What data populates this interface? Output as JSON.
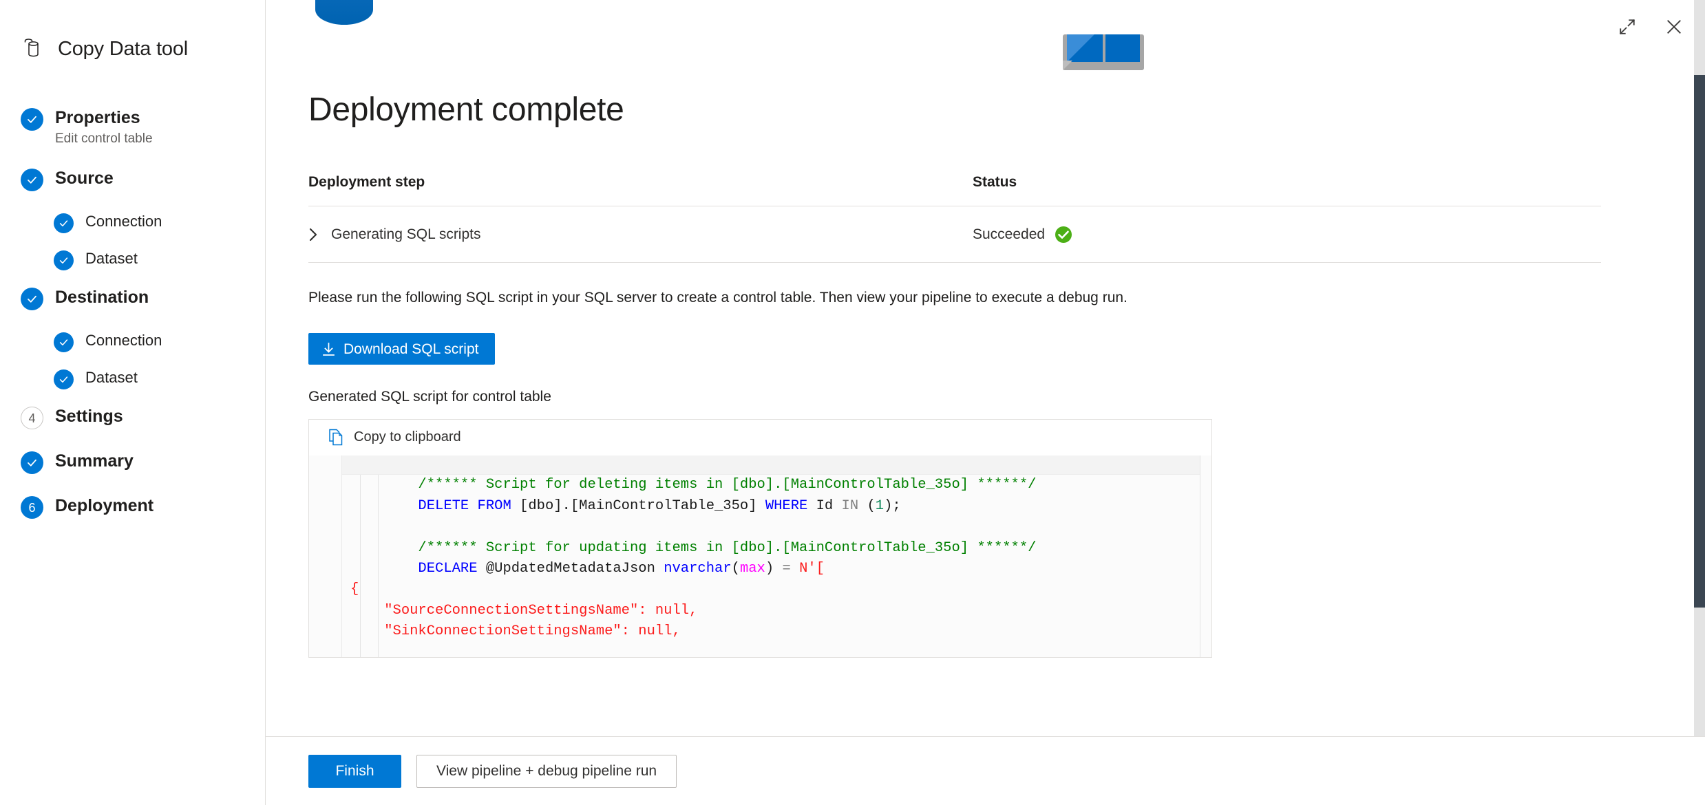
{
  "app": {
    "title": "Copy Data tool",
    "brand_icon": "database-copy-icon"
  },
  "window_controls": {
    "expand_label": "expand-icon",
    "close_label": "close-icon"
  },
  "sidebar": {
    "items": [
      {
        "label": "Properties",
        "sublabel": "Edit control table",
        "state": "done",
        "marker": "check",
        "level": "top"
      },
      {
        "label": "Source",
        "sublabel": "",
        "state": "done",
        "marker": "check",
        "level": "top"
      },
      {
        "label": "Connection",
        "sublabel": "",
        "state": "done",
        "marker": "check",
        "level": "sub"
      },
      {
        "label": "Dataset",
        "sublabel": "",
        "state": "done",
        "marker": "check",
        "level": "sub"
      },
      {
        "label": "Destination",
        "sublabel": "",
        "state": "done",
        "marker": "check",
        "level": "top"
      },
      {
        "label": "Connection",
        "sublabel": "",
        "state": "done",
        "marker": "check",
        "level": "sub"
      },
      {
        "label": "Dataset",
        "sublabel": "",
        "state": "done",
        "marker": "check",
        "level": "sub"
      },
      {
        "label": "Settings",
        "sublabel": "",
        "state": "idle",
        "marker": "4",
        "level": "top"
      },
      {
        "label": "Summary",
        "sublabel": "",
        "state": "done",
        "marker": "check",
        "level": "top"
      },
      {
        "label": "Deployment",
        "sublabel": "",
        "state": "current",
        "marker": "6",
        "level": "top"
      }
    ]
  },
  "main": {
    "page_title": "Deployment complete",
    "table": {
      "headers": [
        "Deployment step",
        "Status"
      ],
      "rows": [
        {
          "step": "Generating SQL scripts",
          "status": "Succeeded",
          "status_icon": "success-check-icon",
          "expander": "chevron-right-icon"
        }
      ]
    },
    "instruction": "Please run the following SQL script in your SQL server to create a control table. Then view your pipeline to execute a debug run.",
    "download_button": "Download SQL script",
    "download_icon": "download-arrow-icon",
    "code_label": "Generated SQL script for control table",
    "copy_button": "Copy to clipboard",
    "copy_icon": "copy-pages-icon",
    "code_lines": [
      {
        "indent": 2,
        "segments": [
          {
            "t": "/****** Script for deleting items in [dbo].[MainControlTable_35o] ******/",
            "c": "cmt"
          }
        ]
      },
      {
        "indent": 2,
        "segments": [
          {
            "t": "DELETE FROM",
            "c": "kw"
          },
          {
            "t": " [dbo].[MainControlTable_35o] ",
            "c": "plain"
          },
          {
            "t": "WHERE",
            "c": "kw"
          },
          {
            "t": " Id ",
            "c": "plain"
          },
          {
            "t": "IN",
            "c": "gray"
          },
          {
            "t": " (",
            "c": "plain"
          },
          {
            "t": "1",
            "c": "num"
          },
          {
            "t": ");",
            "c": "plain"
          }
        ]
      },
      {
        "indent": 0,
        "segments": [
          {
            "t": "",
            "c": "plain"
          }
        ]
      },
      {
        "indent": 2,
        "segments": [
          {
            "t": "/****** Script for updating items in [dbo].[MainControlTable_35o] ******/",
            "c": "cmt"
          }
        ]
      },
      {
        "indent": 2,
        "segments": [
          {
            "t": "DECLARE",
            "c": "kw"
          },
          {
            "t": " @UpdatedMetadataJson ",
            "c": "plain"
          },
          {
            "t": "nvarchar",
            "c": "kw"
          },
          {
            "t": "(",
            "c": "plain"
          },
          {
            "t": "max",
            "c": "mag"
          },
          {
            "t": ") ",
            "c": "plain"
          },
          {
            "t": "=",
            "c": "gray"
          },
          {
            "t": " ",
            "c": "plain"
          },
          {
            "t": "N'[",
            "c": "str"
          }
        ]
      },
      {
        "indent": 0,
        "segments": [
          {
            "t": "{",
            "c": "str"
          }
        ]
      },
      {
        "indent": 1,
        "segments": [
          {
            "t": "\"SourceConnectionSettingsName\": null,",
            "c": "str"
          }
        ]
      },
      {
        "indent": 1,
        "segments": [
          {
            "t": "\"SinkConnectionSettingsName\": null,",
            "c": "str"
          }
        ]
      }
    ]
  },
  "footer": {
    "finish_button": "Finish",
    "view_pipeline_button": "View pipeline + debug pipeline run"
  },
  "colors": {
    "accent": "#0078d4",
    "success": "#4caf16",
    "text": "#201f1e",
    "muted": "#605e5c",
    "border": "#e1dfdd",
    "scroll_thumb": "#3b4652",
    "comment": "#008000",
    "keyword": "#0000ff",
    "string": "#fb1b1b",
    "magenta": "#ff00ff"
  }
}
